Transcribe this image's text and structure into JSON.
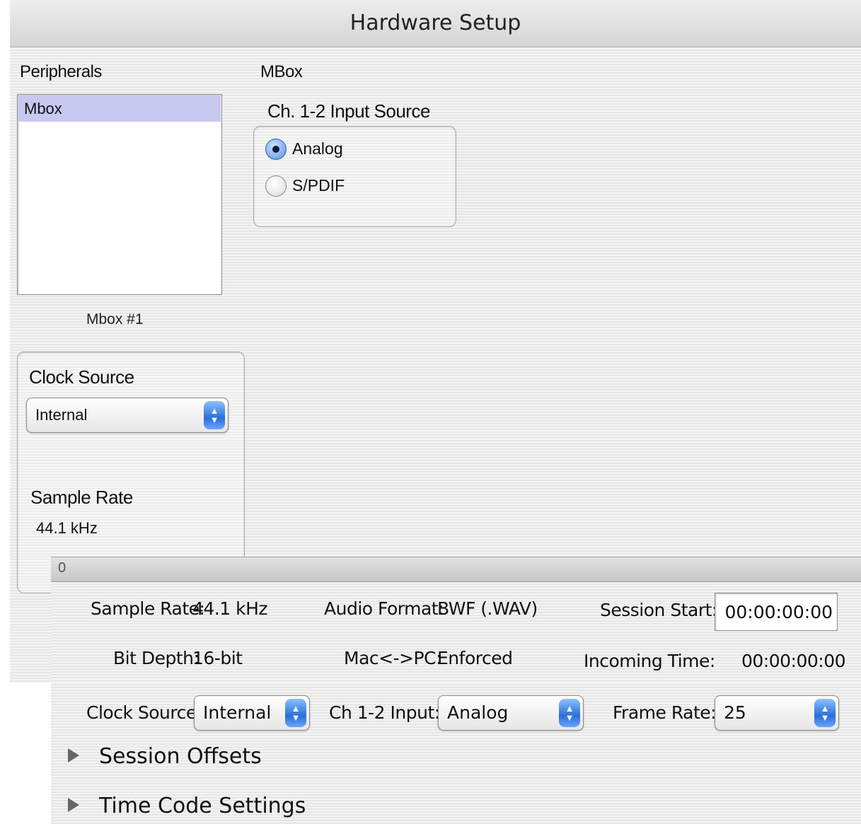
{
  "window": {
    "title": "Hardware Setup"
  },
  "peripherals": {
    "heading": "Peripherals",
    "items": [
      "Mbox"
    ],
    "selected_caption": "Mbox #1"
  },
  "device": {
    "title": "MBox",
    "input_source": {
      "heading": "Ch. 1-2 Input Source",
      "options": [
        {
          "label": "Analog",
          "selected": true
        },
        {
          "label": "S/PDIF",
          "selected": false
        }
      ]
    },
    "clock_source": {
      "heading": "Clock Source",
      "value": "Internal"
    },
    "sample_rate": {
      "heading": "Sample Rate",
      "value": "44.1 kHz"
    }
  },
  "session": {
    "bar_indicator": "0",
    "sample_rate": {
      "label": "Sample Rate:",
      "value": "44.1 kHz"
    },
    "bit_depth": {
      "label": "Bit Depth:",
      "value": "16-bit"
    },
    "audio_format": {
      "label": "Audio Format:",
      "value": "BWF (.WAV)"
    },
    "mac_pc": {
      "label": "Mac<->PC:",
      "value": "Enforced"
    },
    "session_start": {
      "label": "Session Start:",
      "value": "00:00:00:00"
    },
    "incoming_time": {
      "label": "Incoming Time:",
      "value": "00:00:00:00"
    },
    "clock_source": {
      "label": "Clock Source:",
      "value": "Internal"
    },
    "ch12_input": {
      "label": "Ch 1-2 Input:",
      "value": "Analog"
    },
    "frame_rate": {
      "label": "Frame Rate:",
      "value": "25"
    },
    "sections": [
      "Session Offsets",
      "Time Code Settings"
    ]
  },
  "colors": {
    "selection": "#c9c9f0",
    "accent_blue": "#2a6fd8"
  }
}
